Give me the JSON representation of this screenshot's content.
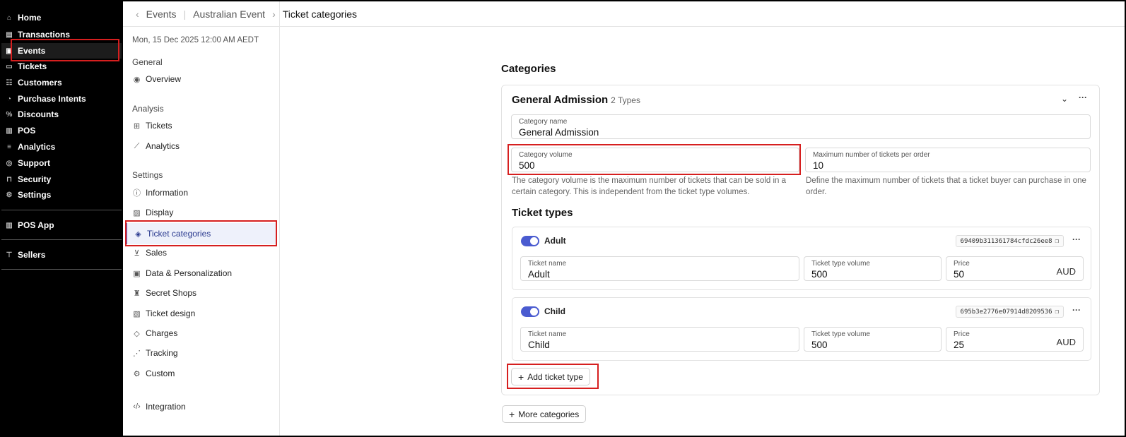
{
  "nav": {
    "items": [
      {
        "label": "Home",
        "icon": "home-icon",
        "glyph": "⌂"
      },
      {
        "label": "Transactions",
        "icon": "transactions-icon",
        "glyph": "▤"
      },
      {
        "label": "Events",
        "icon": "calendar-icon",
        "glyph": "▣"
      },
      {
        "label": "Tickets",
        "icon": "ticket-icon",
        "glyph": "▭"
      },
      {
        "label": "Customers",
        "icon": "customers-icon",
        "glyph": "☷"
      },
      {
        "label": "Purchase Intents",
        "icon": "purchase-intents-icon",
        "glyph": "◔"
      },
      {
        "label": "Discounts",
        "icon": "discount-icon",
        "glyph": "%"
      },
      {
        "label": "POS",
        "icon": "pos-icon",
        "glyph": "▥"
      },
      {
        "label": "Analytics",
        "icon": "analytics-icon",
        "glyph": "≡"
      },
      {
        "label": "Support",
        "icon": "support-icon",
        "glyph": "◎"
      },
      {
        "label": "Security",
        "icon": "lock-icon",
        "glyph": "⊓"
      },
      {
        "label": "Settings",
        "icon": "settings-icon",
        "glyph": "⚙"
      }
    ],
    "pos_app": {
      "label": "POS App",
      "icon": "pos-app-icon",
      "glyph": "▥"
    },
    "sellers": {
      "label": "Sellers",
      "icon": "sellers-icon",
      "glyph": "⊤"
    }
  },
  "breadcrumb": {
    "back": "Events",
    "event": "Australian Event",
    "current": "Ticket categories"
  },
  "side": {
    "date": "Mon, 15 Dec 2025 12:00 AM AEDT",
    "general_title": "General",
    "overview": "Overview",
    "analysis_title": "Analysis",
    "tickets": "Tickets",
    "analytics": "Analytics",
    "settings_title": "Settings",
    "information": "Information",
    "display": "Display",
    "ticket_categories": "Ticket categories",
    "sales": "Sales",
    "data_personalization": "Data & Personalization",
    "secret_shops": "Secret Shops",
    "ticket_design": "Ticket design",
    "charges": "Charges",
    "tracking": "Tracking",
    "custom": "Custom",
    "integration": "Integration"
  },
  "main": {
    "title": "Categories",
    "category": {
      "name": "General Admission",
      "types_count": "2 Types",
      "name_label": "Category name",
      "name_value": "General Admission",
      "volume_label": "Category volume",
      "volume_value": "500",
      "max_label": "Maximum number of tickets per order",
      "max_value": "10",
      "volume_help": "The category volume is the maximum number of tickets that can be sold in a certain category. This is independent from the ticket type volumes.",
      "max_help": "Define the maximum number of tickets that a ticket buyer can purchase in one order."
    },
    "ticket_types_title": "Ticket types",
    "ticket_types": [
      {
        "name": "Adult",
        "id": "69409b311361784cfdc26ee8",
        "ticket_name_label": "Ticket name",
        "ticket_name": "Adult",
        "volume_label": "Ticket type volume",
        "volume": "500",
        "price_label": "Price",
        "price": "50",
        "currency": "AUD",
        "enabled": true
      },
      {
        "name": "Child",
        "id": "695b3e2776e07914d8209536",
        "ticket_name_label": "Ticket name",
        "ticket_name": "Child",
        "volume_label": "Ticket type volume",
        "volume": "500",
        "price_label": "Price",
        "price": "25",
        "currency": "AUD",
        "enabled": true
      }
    ],
    "add_ticket_type": "Add ticket type",
    "more_categories": "More categories"
  },
  "colors": {
    "accent": "#4a5bd0",
    "highlight": "#d61f1f",
    "nav_bg": "#000000"
  }
}
